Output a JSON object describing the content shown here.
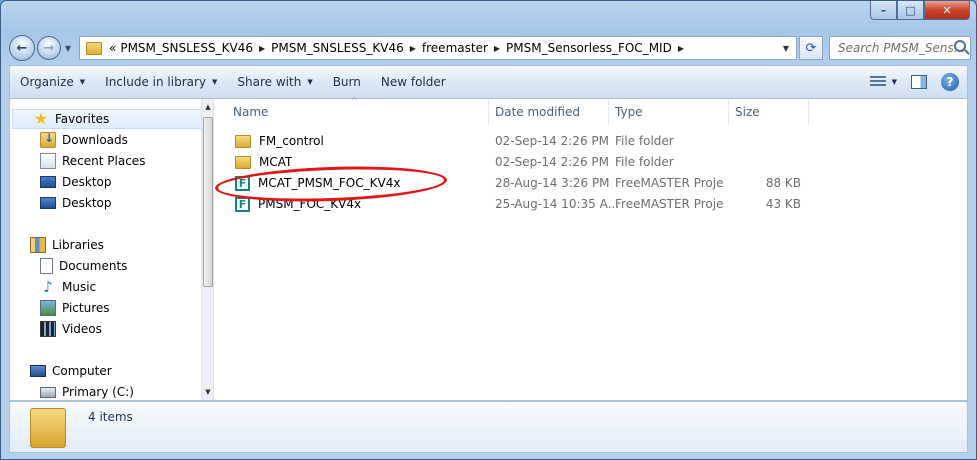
{
  "address": {
    "overflow": "«",
    "parts": [
      "PMSM_SNSLESS_KV46",
      "PMSM_SNSLESS_KV46",
      "freemaster",
      "PMSM_Sensorless_FOC_MID"
    ]
  },
  "search": {
    "placeholder": "Search PMSM_Sens..."
  },
  "toolbar": {
    "organize": "Organize",
    "include_in_library": "Include in library",
    "share_with": "Share with",
    "burn": "Burn",
    "new_folder": "New folder",
    "help": "?"
  },
  "sidebar": {
    "favorites": "Favorites",
    "favorites_items": [
      "Downloads",
      "Recent Places",
      "Desktop",
      "Desktop"
    ],
    "libraries": "Libraries",
    "library_items": [
      "Documents",
      "Music",
      "Pictures",
      "Videos"
    ],
    "computer": "Computer",
    "computer_items": [
      "Primary (C:)"
    ]
  },
  "columns": {
    "name": "Name",
    "date": "Date modified",
    "type": "Type",
    "size": "Size"
  },
  "files": [
    {
      "name": "FM_control",
      "date": "02-Sep-14 2:26 PM",
      "type": "File folder",
      "size": "",
      "icon": "folder-icon"
    },
    {
      "name": "MCAT",
      "date": "02-Sep-14 2:26 PM",
      "type": "File folder",
      "size": "",
      "icon": "folder-icon"
    },
    {
      "name": "MCAT_PMSM_FOC_KV4x",
      "date": "28-Aug-14 3:26 PM",
      "type": "FreeMASTER Proje...",
      "size": "88 KB",
      "icon": "freemaster-icon"
    },
    {
      "name": "PMSM_FOC_KV4x",
      "date": "25-Aug-14 10:35 A...",
      "type": "FreeMASTER Proje...",
      "size": "43 KB",
      "icon": "freemaster-icon"
    }
  ],
  "details": {
    "item_count": "4 items"
  },
  "colors": {
    "highlight_ring": "#e01515",
    "freemaster_icon": "#11857d"
  }
}
